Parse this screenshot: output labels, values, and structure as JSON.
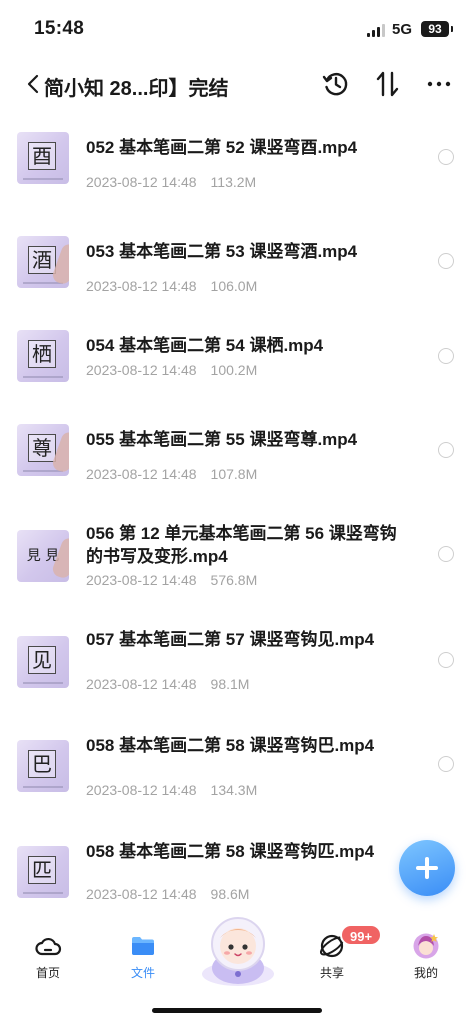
{
  "status_bar": {
    "time": "15:48",
    "network": "5G",
    "battery": "93"
  },
  "header": {
    "title": "简小知 28...印】完结",
    "back_icon": "chevron-left-icon",
    "actions": [
      "history-icon",
      "sort-icon",
      "more-icon"
    ]
  },
  "files": [
    {
      "name": "052 基本笔画二第 52 课竖弯酉.mp4",
      "date": "2023-08-12 14:48",
      "size": "113.2M",
      "thumb_char": "酉"
    },
    {
      "name": "053 基本笔画二第 53 课竖弯酒.mp4",
      "date": "2023-08-12 14:48",
      "size": "106.0M",
      "thumb_char": "酒"
    },
    {
      "name": "054 基本笔画二第 54 课栖.mp4",
      "date": "2023-08-12 14:48",
      "size": "100.2M",
      "thumb_char": "栖"
    },
    {
      "name": "055 基本笔画二第 55 课竖弯尊.mp4",
      "date": "2023-08-12 14:48",
      "size": "107.8M",
      "thumb_char": "尊"
    },
    {
      "name": "056 第 12 单元基本笔画二第 56 课竖弯钩的书写及变形.mp4",
      "date": "2023-08-12 14:48",
      "size": "576.8M",
      "thumb_char": "见"
    },
    {
      "name": "057 基本笔画二第 57 课竖弯钩见.mp4",
      "date": "2023-08-12 14:48",
      "size": "98.1M",
      "thumb_char": "见"
    },
    {
      "name": "058 基本笔画二第 58 课竖弯钩巴.mp4",
      "date": "2023-08-12 14:48",
      "size": "134.3M",
      "thumb_char": "巴"
    },
    {
      "name": "058 基本笔画二第 58 课竖弯钩匹.mp4",
      "date": "2023-08-12 14:48",
      "size": "98.6M",
      "thumb_char": "匹"
    }
  ],
  "fab": {
    "icon": "plus-icon"
  },
  "tabs": [
    {
      "label": "首页",
      "icon": "cloud-icon"
    },
    {
      "label": "文件",
      "icon": "folder-icon",
      "active": true
    },
    {
      "label": "共享",
      "icon": "orbit-icon",
      "badge": "99+"
    },
    {
      "label": "我的",
      "icon": "avatar-icon"
    }
  ],
  "colors": {
    "accent": "#3a8df6",
    "badge": "#f06363",
    "thumb_bg": "#d9d0f0",
    "meta_text": "#a3a3a3"
  }
}
